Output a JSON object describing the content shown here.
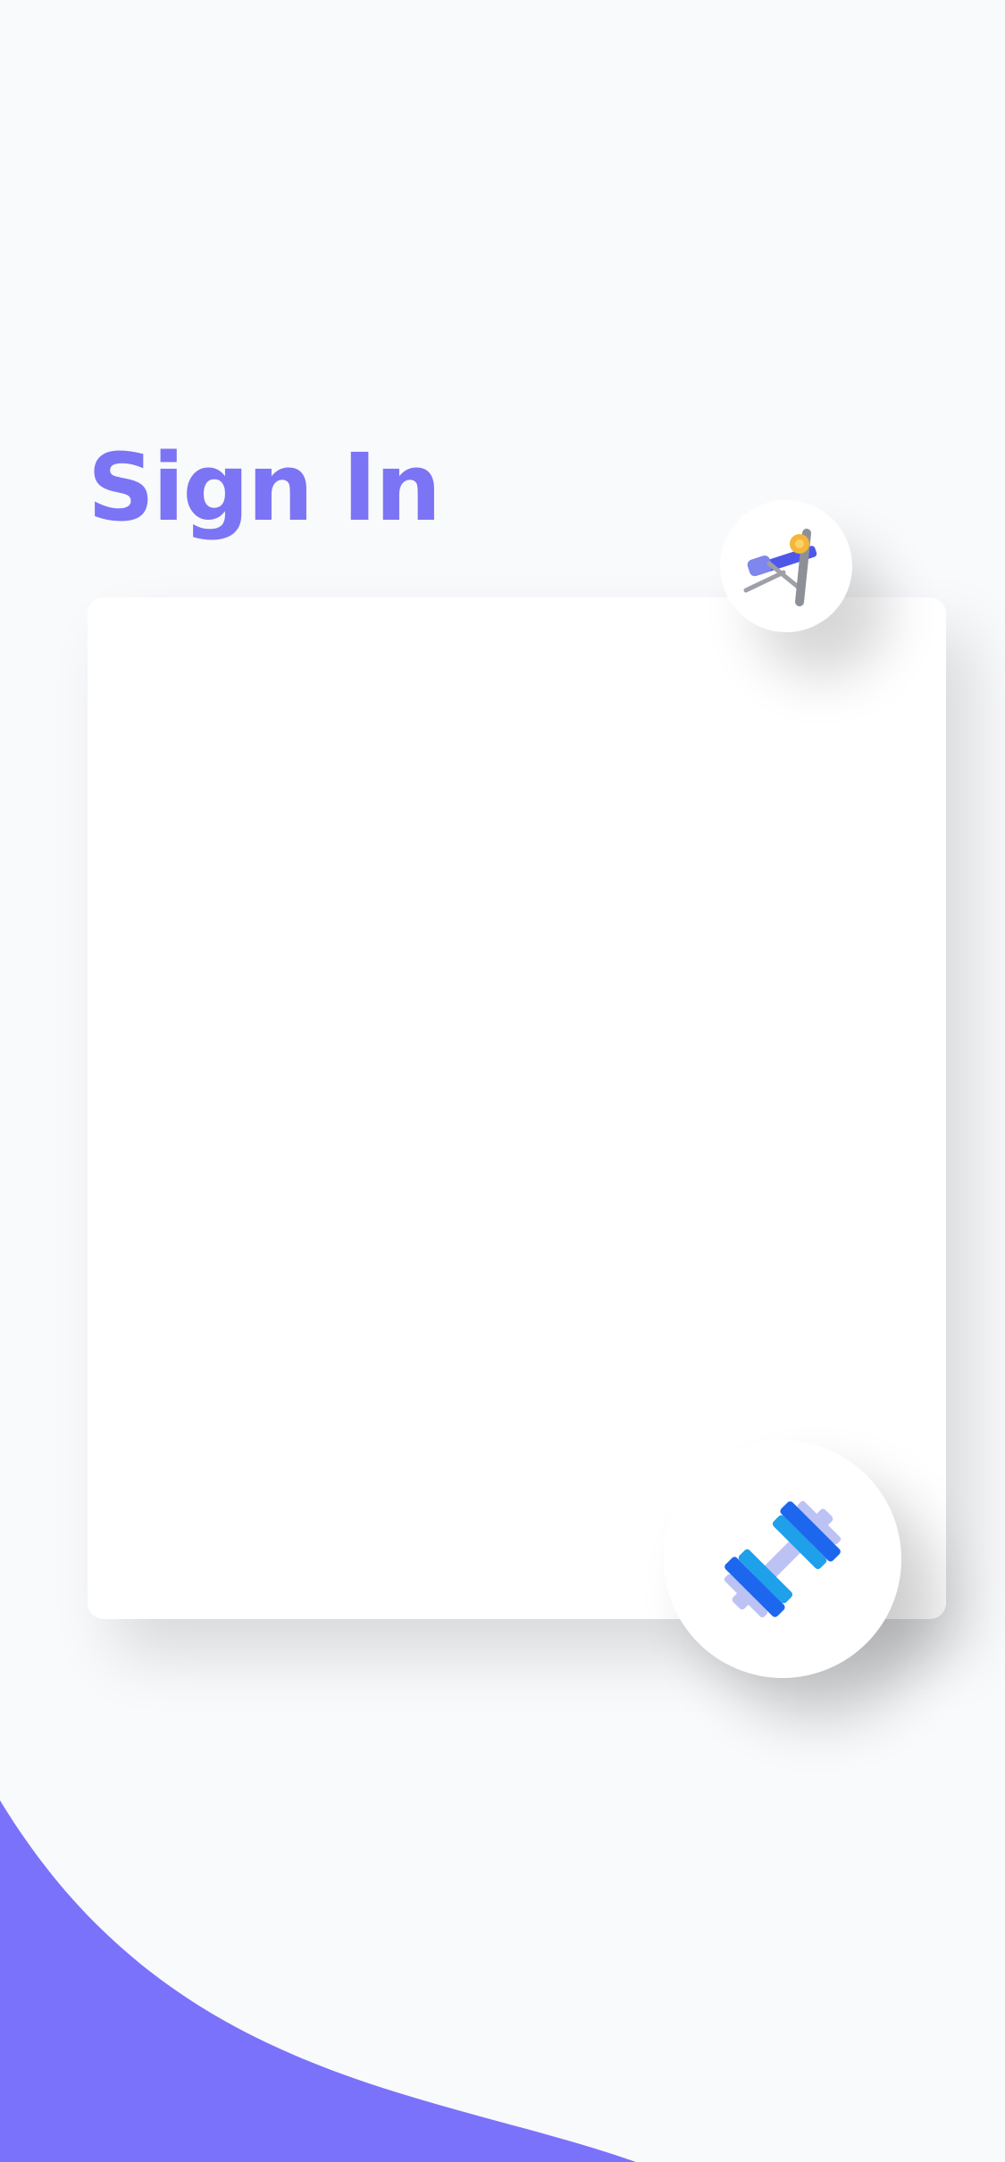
{
  "screen": {
    "title": "Sign In"
  },
  "theme": {
    "background": "#f9fafc",
    "accent": "#7b74f5",
    "card": "#ffffff",
    "wave": "#7a72fa"
  },
  "icons": {
    "top": "weight-bench-icon",
    "bottom": "dumbbell-icon"
  }
}
